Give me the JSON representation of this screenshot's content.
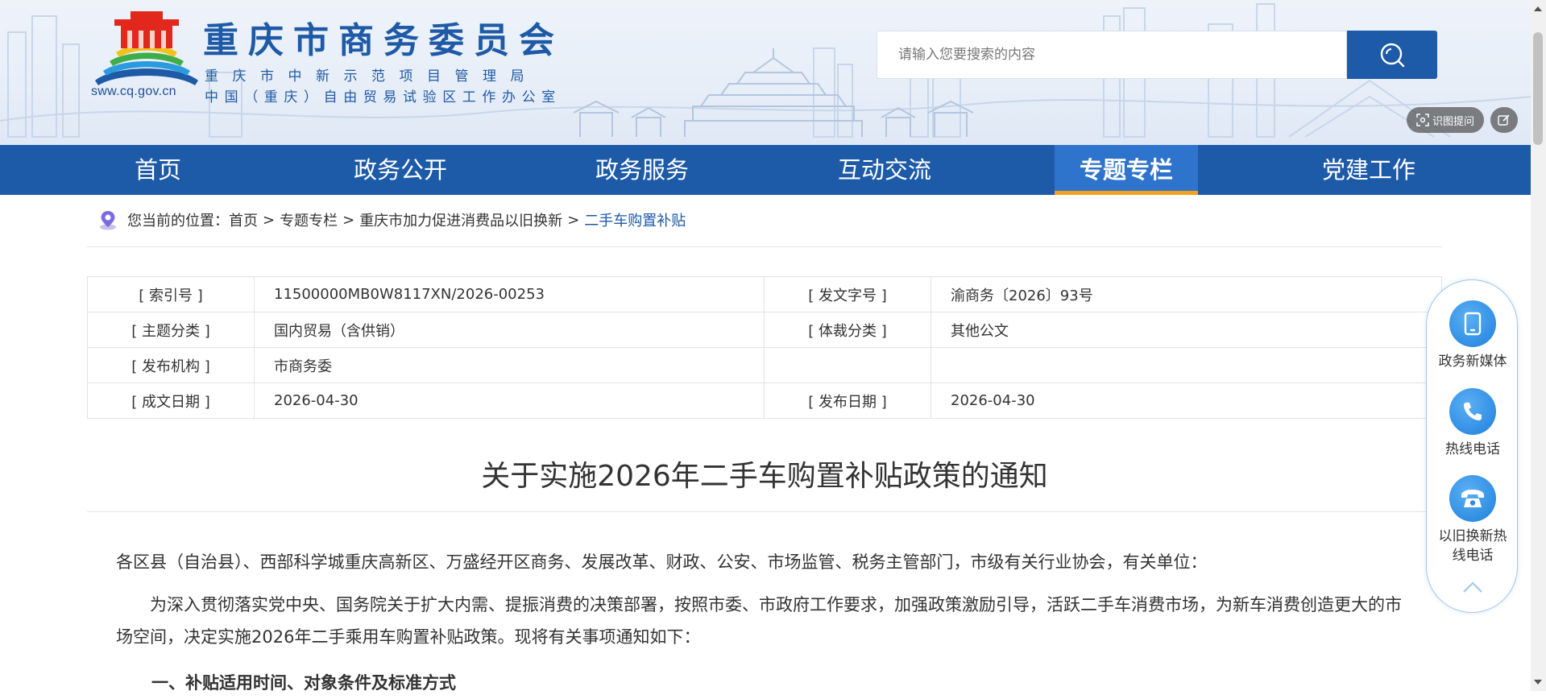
{
  "header": {
    "site_title": "重庆市商务委员会",
    "subtitle_1": "重庆市中新示范项目管理局",
    "subtitle_2": "中国（重庆）自由贸易试验区工作办公室",
    "domain": "sww.cq.gov.cn",
    "search_placeholder": "请输入您要搜索的内容",
    "ai_button_label": "识图提问"
  },
  "nav": {
    "items": [
      {
        "label": "首页"
      },
      {
        "label": "政务公开"
      },
      {
        "label": "政务服务"
      },
      {
        "label": "互动交流"
      },
      {
        "label": "专题专栏"
      },
      {
        "label": "党建工作"
      }
    ],
    "active_index": 4,
    "active_color": "#f1a020"
  },
  "breadcrumb": {
    "prefix": "您当前的位置：",
    "items": [
      "首页",
      "专题专栏",
      "重庆市加力促进消费品以旧换新",
      "二手车购置补贴"
    ],
    "separator": ">"
  },
  "meta": {
    "index_label": "[ 索引号 ]",
    "index_value": "11500000MB0W8117XN/2026-00253",
    "docno_label": "[ 发文字号 ]",
    "docno_value": "渝商务〔2026〕93号",
    "topic_label": "[ 主题分类 ]",
    "topic_value": "国内贸易（含供销）",
    "genre_label": "[ 体裁分类 ]",
    "genre_value": "其他公文",
    "org_label": "[ 发布机构 ]",
    "org_value": "市商务委",
    "written_label": "[ 成文日期 ]",
    "written_value": "2026-04-30",
    "published_label": "[ 发布日期 ]",
    "published_value": "2026-04-30"
  },
  "article": {
    "title": "关于实施2026年二手车购置补贴政策的通知",
    "para_0": "各区县（自治县）、西部科学城重庆高新区、万盛经开区商务、发展改革、财政、公安、市场监管、税务主管部门，市级有关行业协会，有关单位：",
    "para_1": "为深入贯彻落实党中央、国务院关于扩大内需、提振消费的决策部署，按照市委、市政府工作要求，加强政策激励引导，活跃二手车消费市场，为新车消费创造更大的市场空间，决定实施2026年二手乘用车购置补贴政策。现将有关事项通知如下：",
    "heading_1": "一、补贴适用时间、对象条件及标准方式"
  },
  "float_panel": {
    "items": [
      {
        "label": "政务新媒体",
        "icon": "tablet-icon"
      },
      {
        "label": "热线电话",
        "icon": "phone-icon"
      },
      {
        "label": "以旧换新热线电话",
        "icon": "telephone-icon"
      }
    ]
  },
  "colors": {
    "brand_blue": "#1d5aa8",
    "nav_active": "#2f74cc",
    "accent_orange": "#f1a020"
  }
}
